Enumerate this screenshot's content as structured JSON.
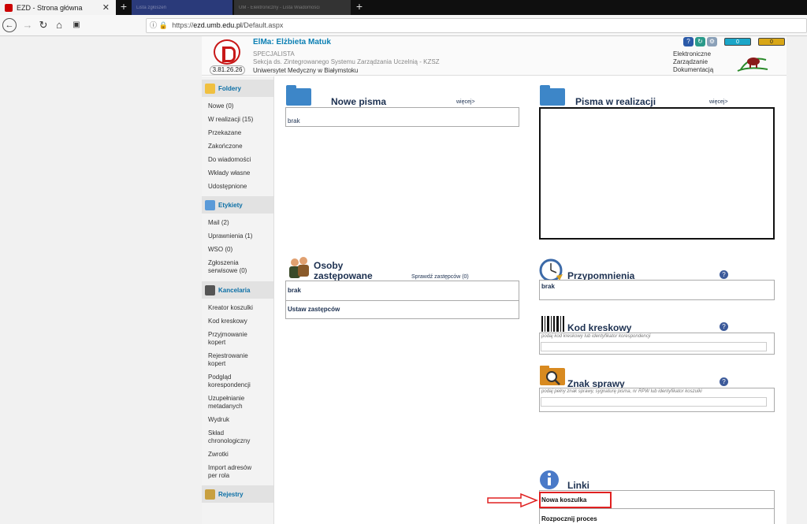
{
  "browser": {
    "active_tab": "EZD - Strona główna",
    "other_tabs": [
      "Lista zgłoszeń",
      "UM - Elektroniczny - Lista Wiadomości"
    ],
    "url_prefix": "https://",
    "url_domain": "ezd.umb.edu.pl",
    "url_path": "/Default.aspx"
  },
  "header": {
    "username": "ElMa: Elżbieta Matuk",
    "role": "SPECJALISTA",
    "section": "Sekcja ds. Zintegrowanego Systemu Zarządzania Uczelnią - KZSZ",
    "university": "Uniwersytet Medyczny w Białymstoku",
    "version": "3.81.26.26",
    "counter1": "0",
    "counter2": "0",
    "ezd_line1": "Elektroniczne",
    "ezd_line2": "Zarządzanie",
    "ezd_line3": "Dokumentacją",
    "colors": {
      "user_blue": "#0b7fb3",
      "counter_teal": "#1ba6c8",
      "counter_gold": "#d8a617"
    }
  },
  "sidebar": {
    "folders_title": "Foldery",
    "folders": [
      "Nowe (0)",
      "W realizacji (15)",
      "Przekazane",
      "Zakończone",
      "Do wiadomości",
      "Wkłady własne",
      "Udostępnione"
    ],
    "labels_title": "Etykiety",
    "labels": [
      "Mail (2)",
      "Uprawnienia (1)",
      "WSO (0)",
      "Zgłoszenia serwisowe (0)"
    ],
    "office_title": "Kancelaria",
    "office": [
      "Kreator koszulki",
      "Kod kreskowy",
      "Przyjmowanie kopert",
      "Rejestrowanie kopert",
      "Podgląd korespondencji",
      "Uzupełnianie metadanych",
      "Wydruk",
      "Skład chronologiczny",
      "Zwrotki",
      "Import adresów per rola"
    ],
    "registers_title": "Rejestry"
  },
  "panels": {
    "new_letters": {
      "title": "Nowe pisma",
      "more": "więcej>",
      "content": "brak"
    },
    "in_progress": {
      "title": "Pisma w realizacji",
      "more": "więcej>"
    },
    "substitutes": {
      "title_line1": "Osoby",
      "title_line2": "zastępowane",
      "check": "Sprawdź zastępców (0)",
      "content": "brak",
      "action": "Ustaw zastępców"
    },
    "reminders": {
      "title": "Przypomnienia",
      "content": "brak"
    },
    "barcode": {
      "title": "Kod kreskowy",
      "hint": "podaj kod kreskowy lub identyfikator korespondencji"
    },
    "case_sign": {
      "title": "Znak sprawy",
      "hint": "podaj pełny znak sprawy, sygnaturę pisma, nr RPW lub identyfikator koszulki"
    },
    "links": {
      "title": "Linki",
      "items": [
        "Nowa koszulka",
        "Rozpocznij proces"
      ]
    }
  }
}
